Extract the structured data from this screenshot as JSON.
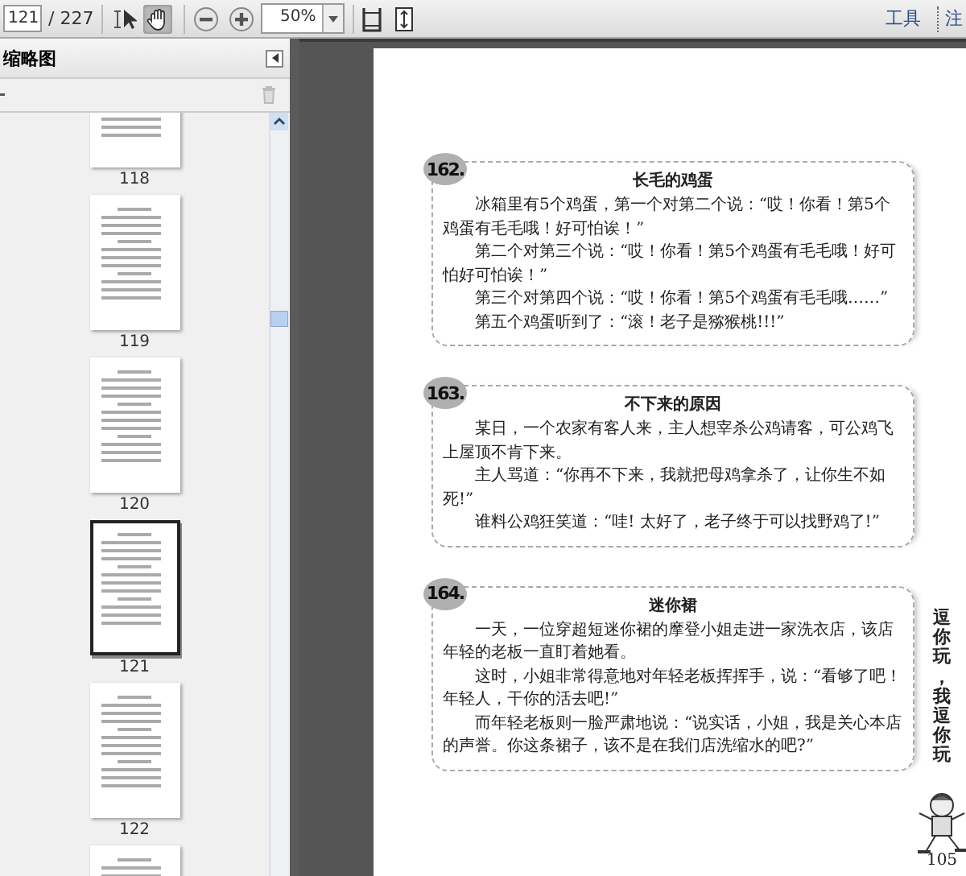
{
  "toolbar": {
    "page_input": "121",
    "page_total": "/ 227",
    "tools": [
      {
        "kind": "select",
        "selected": false
      },
      {
        "kind": "hand",
        "selected": true
      }
    ],
    "zoom": "50%",
    "links": [
      "工具",
      "注"
    ]
  },
  "sidebar": {
    "title": "缩略图",
    "thumbnails": [
      {
        "label": "118",
        "selected": false
      },
      {
        "label": "119",
        "selected": false
      },
      {
        "label": "120",
        "selected": false
      },
      {
        "label": "121",
        "selected": true
      },
      {
        "label": "122",
        "selected": false
      }
    ]
  },
  "page": {
    "jokes": [
      {
        "number": "162.",
        "title": "长毛的鸡蛋",
        "paragraphs": [
          "冰箱里有5个鸡蛋，第一个对第二个说：“哎！你看！第5个鸡蛋有毛毛哦！好可怕诶！”",
          "第二个对第三个说：“哎！你看！第5个鸡蛋有毛毛哦！好可怕好可怕诶！”",
          "第三个对第四个说：“哎！你看！第5个鸡蛋有毛毛哦……”",
          "第五个鸡蛋听到了：“滚！老子是猕猴桃!!!”"
        ]
      },
      {
        "number": "163.",
        "title": "不下来的原因",
        "paragraphs": [
          "某日，一个农家有客人来，主人想宰杀公鸡请客，可公鸡飞上屋顶不肯下来。",
          "主人骂道：“你再不下来，我就把母鸡拿杀了，让你生不如死!”",
          "谁料公鸡狂笑道：“哇! 太好了，老子终于可以找野鸡了!”"
        ]
      },
      {
        "number": "164.",
        "title": "迷你裙",
        "paragraphs": [
          "一天，一位穿超短迷你裙的摩登小姐走进一家洗衣店，该店年轻的老板一直盯着她看。",
          "这时，小姐非常得意地对年轻老板挥挥手，说：“看够了吧！年轻人，干你的活去吧!”",
          "而年轻老板则一脸严肃地说：“说实话，小姐，我是关心本店的声誉。你这条裙子，该不是在我们店洗缩水的吧?”"
        ]
      }
    ],
    "side_title": "逗你玩，我逗你玩",
    "page_number": "105"
  }
}
